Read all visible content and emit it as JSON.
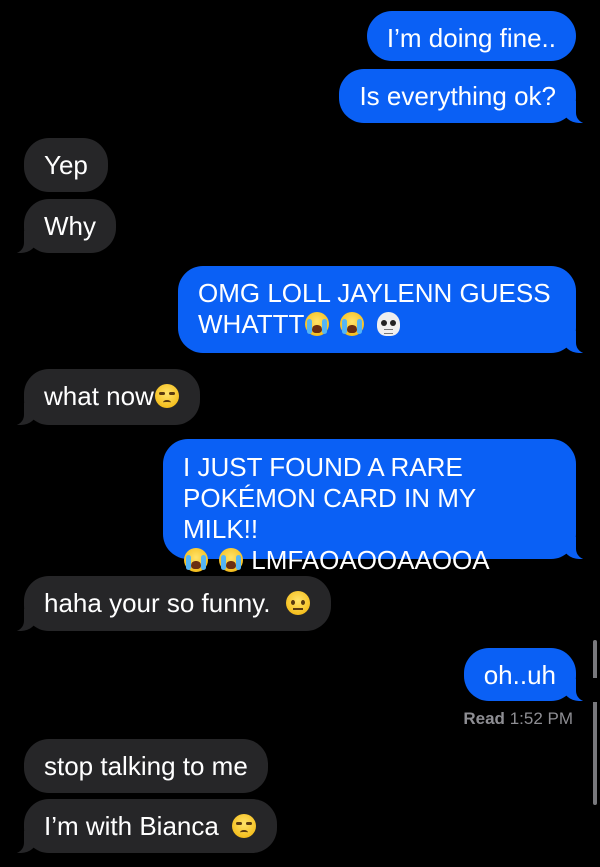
{
  "conversation": {
    "messages": [
      {
        "id": "m1",
        "direction": "outgoing",
        "text": "I’m doing fine.."
      },
      {
        "id": "m2",
        "direction": "outgoing",
        "text": "Is everything ok?"
      },
      {
        "id": "m3",
        "direction": "incoming",
        "text": "Yep"
      },
      {
        "id": "m4",
        "direction": "incoming",
        "text": "Why"
      },
      {
        "id": "m5",
        "direction": "outgoing",
        "line1": "OMG LOLL JAYLENN GUESS",
        "line2": "WHATTT",
        "emojis": [
          "loudly-crying-face-icon",
          "loudly-crying-face-icon",
          "skull-icon"
        ]
      },
      {
        "id": "m6",
        "direction": "incoming",
        "text": "what now",
        "emojis": [
          "unamused-face-icon"
        ]
      },
      {
        "id": "m7",
        "direction": "outgoing",
        "line1": "I JUST FOUND A RARE",
        "line2": "POKÉMON CARD IN MY MILK!!",
        "line3": "LMFAOAOOAAOOA",
        "emojis": [
          "loudly-crying-face-icon",
          "loudly-crying-face-icon"
        ]
      },
      {
        "id": "m8",
        "direction": "incoming",
        "text": "haha your so funny.",
        "emojis": [
          "face-with-raised-eyebrow-icon"
        ]
      },
      {
        "id": "m9",
        "direction": "outgoing",
        "text": "oh..uh"
      },
      {
        "id": "m10",
        "direction": "incoming",
        "text": "stop talking to me"
      },
      {
        "id": "m11",
        "direction": "incoming",
        "text": "I’m with Bianca",
        "emojis": [
          "unamused-face-icon"
        ]
      }
    ],
    "read_receipt": {
      "label": "Read",
      "time": "1:52 PM"
    }
  },
  "colors": {
    "background": "#000000",
    "outgoing_bubble": "#0a60f5",
    "incoming_bubble": "#262628",
    "text": "#ffffff",
    "receipt_text": "#8e8e93"
  }
}
